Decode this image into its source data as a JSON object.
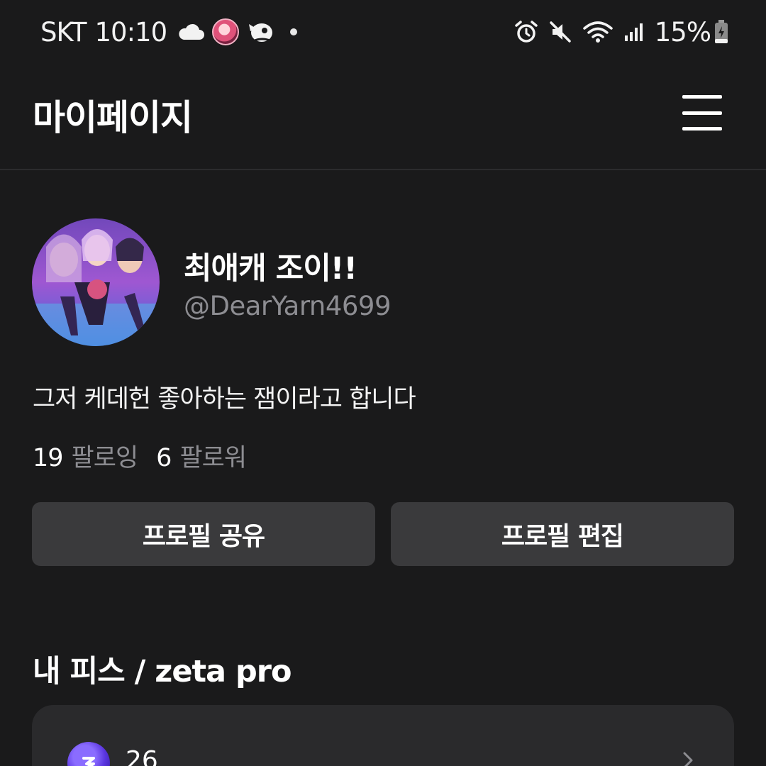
{
  "status_bar": {
    "carrier": "SKT",
    "time": "10:10",
    "battery": "15%",
    "icons_left": [
      "cloud-icon",
      "notification-avatar-icon",
      "app-rocket-icon",
      "dot-icon"
    ],
    "icons_right": [
      "alarm-icon",
      "mute-icon",
      "wifi-icon",
      "signal-icon",
      "battery-charging-icon"
    ]
  },
  "header": {
    "title": "마이페이지",
    "menu_icon": "hamburger-menu-icon"
  },
  "profile": {
    "display_name": "최애캐 조이!!",
    "username": "@DearYarn4699",
    "bio": "그저 케데헌 좋아하는 잼이라고 합니다",
    "following_count": "19",
    "following_label": "팔로잉",
    "followers_count": "6",
    "followers_label": "팔로워"
  },
  "actions": {
    "share_label": "프로필 공유",
    "edit_label": "프로필 편집"
  },
  "pieces": {
    "section_title": "내 피스 / zeta pro",
    "count": "26"
  },
  "colors": {
    "background": "#1a1a1b",
    "button_bg": "#3a3a3c",
    "card_bg": "#2a2a2c",
    "muted_text": "#8d8d92",
    "accent": "#5a35e0"
  }
}
